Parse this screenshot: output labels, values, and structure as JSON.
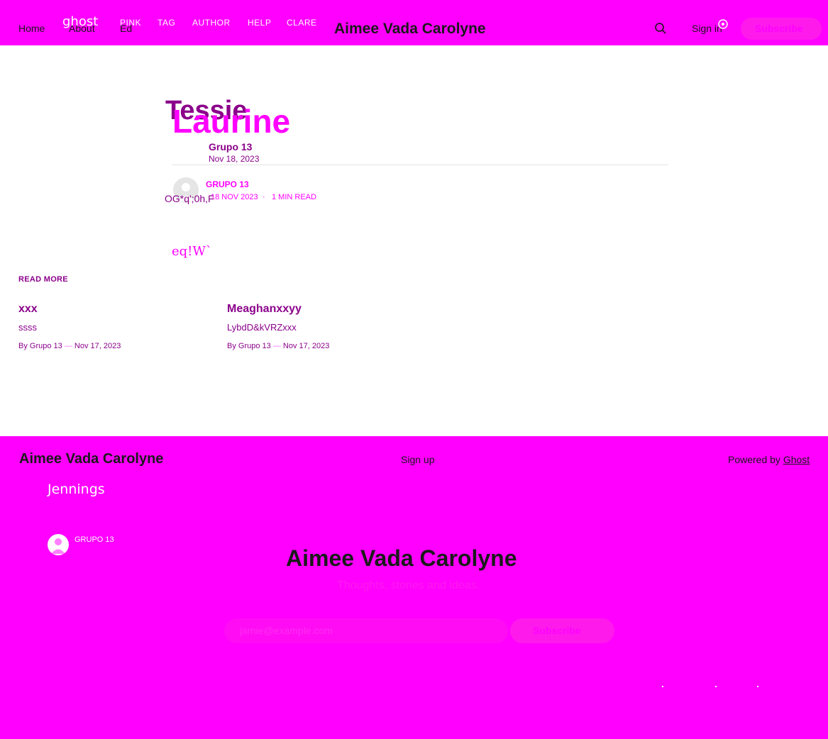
{
  "header": {
    "nav": [
      "Home",
      "About",
      "Ed"
    ],
    "logo": "ghost",
    "overlay_nav": [
      "PINK",
      "TAG",
      "AUTHOR",
      "HELP",
      "CLARE"
    ],
    "site_title": "Aimee Vada Carolyne",
    "sign_in": "Sign in",
    "subscribe": "Subscribe"
  },
  "featured": {
    "title": "Tessie",
    "overlay_title": "Laurine",
    "author": "Grupo 13",
    "date": "Nov 18, 2023",
    "meta_author": "GRUPO 13",
    "meta_date": "18 NOV 2023",
    "meta_sep": "·",
    "meta_read": "1 MIN READ",
    "garbled_text": "OG*q';0h,F",
    "excerpt": "eq!W`",
    "read_more": "READ MORE"
  },
  "posts": [
    {
      "title": "xxx",
      "excerpt": "ssss",
      "by": "By",
      "author": "Grupo 13",
      "sep": "—",
      "date": "Nov 17, 2023"
    },
    {
      "title": "Meaghanxxyy",
      "excerpt": "LybdD&kVRZxxx",
      "by": "By",
      "author": "Grupo 13",
      "sep": "—",
      "date": "Nov 17, 2023"
    }
  ],
  "footer": {
    "site_title": "Aimee Vada Carolyne",
    "signup": "Sign up",
    "powered_prefix": "Powered by",
    "powered_link": "Ghost",
    "overlay_tag": "Jennings",
    "overlay_author": "GRUPO 13",
    "cta_title": "Aimee Vada Carolyne",
    "cta_subtitle": "Thoughts, stories and ideas.",
    "email_placeholder": "jamie@example.com",
    "cta_button": "Subscribe"
  },
  "colors": {
    "accent": "#ff00ff",
    "dark_purple": "#8b008b",
    "text": "#1a1a1a"
  }
}
